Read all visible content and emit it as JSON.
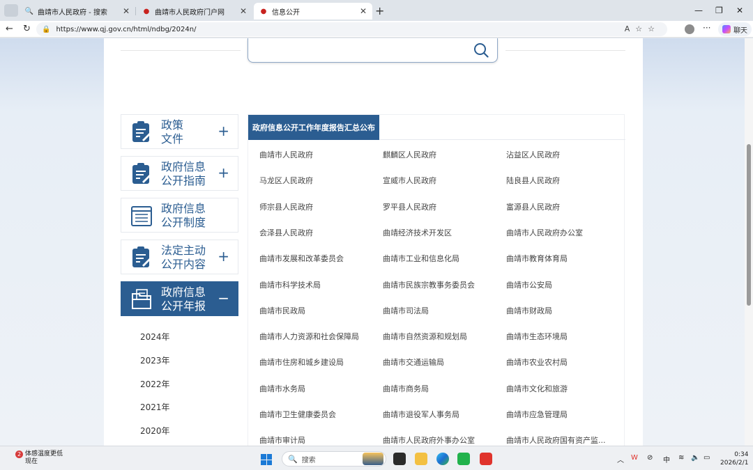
{
  "browser": {
    "tabs": [
      {
        "title": "曲靖市人民政府 - 搜索",
        "active": false
      },
      {
        "title": "曲靖市人民政府门户网",
        "active": false
      },
      {
        "title": "信息公开",
        "active": true
      }
    ],
    "url": "https://www.qj.gov.cn/html/ndbg/2024n/",
    "chat_label": "聊天"
  },
  "sidebar": {
    "items": [
      {
        "label": "政策文件",
        "line1": "政策",
        "line2": "文件",
        "toggle": "+",
        "active": false
      },
      {
        "label": "政府信息公开指南",
        "line1": "政府信息",
        "line2": "公开指南",
        "toggle": "+",
        "active": false
      },
      {
        "label": "政府信息公开制度",
        "line1": "政府信息",
        "line2": "公开制度",
        "toggle": "",
        "active": false
      },
      {
        "label": "法定主动公开内容",
        "line1": "法定主动",
        "line2": "公开内容",
        "toggle": "+",
        "active": false
      },
      {
        "label": "政府信息公开年报",
        "line1": "政府信息",
        "line2": "公开年报",
        "toggle": "−",
        "active": true
      }
    ],
    "years": [
      "2024年",
      "2023年",
      "2022年",
      "2021年",
      "2020年"
    ]
  },
  "main": {
    "title": "政府信息公开工作年度报告汇总公布",
    "orgs": [
      "曲靖市人民政府",
      "麒麟区人民政府",
      "沾益区人民政府",
      "马龙区人民政府",
      "宣威市人民政府",
      "陆良县人民政府",
      "师宗县人民政府",
      "罗平县人民政府",
      "富源县人民政府",
      "会泽县人民政府",
      "曲靖经济技术开发区",
      "曲靖市人民政府办公室",
      "曲靖市发展和改革委员会",
      "曲靖市工业和信息化局",
      "曲靖市教育体育局",
      "曲靖市科学技术局",
      "曲靖市民族宗教事务委员会",
      "曲靖市公安局",
      "曲靖市民政局",
      "曲靖市司法局",
      "曲靖市财政局",
      "曲靖市人力资源和社会保障局",
      "曲靖市自然资源和规划局",
      "曲靖市生态环境局",
      "曲靖市住房和城乡建设局",
      "曲靖市交通运输局",
      "曲靖市农业农村局",
      "曲靖市水务局",
      "曲靖市商务局",
      "曲靖市文化和旅游",
      "曲靖市卫生健康委员会",
      "曲靖市退役军人事务局",
      "曲靖市应急管理局",
      "曲靖市审计局",
      "曲靖市人民政府外事办公室",
      "曲靖市人民政府国有资产监..."
    ]
  },
  "taskbar": {
    "weather_badge": "2",
    "weather_line1": "体感温度更低",
    "weather_line2": "现在",
    "search_placeholder": "搜索",
    "ime": "中",
    "time": "0:34",
    "date": "2026/2/1"
  }
}
